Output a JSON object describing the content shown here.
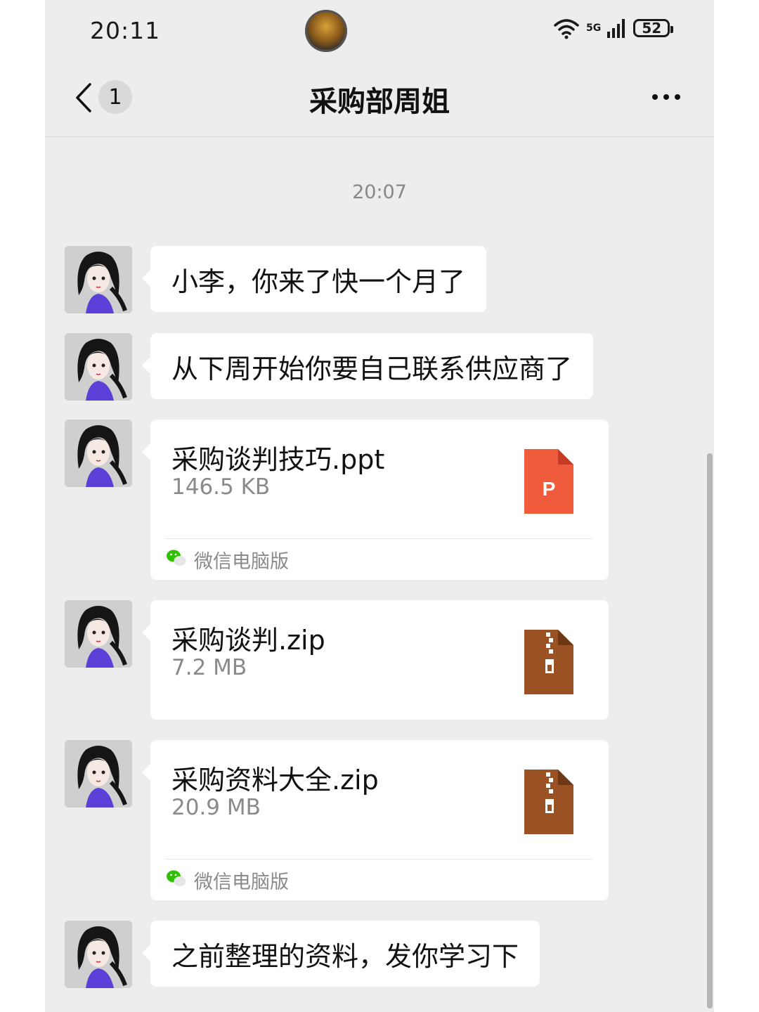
{
  "status_bar": {
    "time": "20:11",
    "network": "5G",
    "battery": "52"
  },
  "header": {
    "unread_count": "1",
    "title": "采购部周姐"
  },
  "chat": {
    "timestamp": "20:07",
    "messages": [
      {
        "type": "text",
        "text": "小李，你来了快一个月了"
      },
      {
        "type": "text",
        "text": "从下周开始你要自己联系供应商了"
      },
      {
        "type": "file",
        "name": "采购谈判技巧.ppt",
        "size": "146.5 KB",
        "file_icon": "ppt-file-icon",
        "footer": "微信电脑版"
      },
      {
        "type": "file",
        "name": "采购谈判.zip",
        "size": "7.2 MB",
        "file_icon": "zip-file-icon"
      },
      {
        "type": "file",
        "name": "采购资料大全.zip",
        "size": "20.9 MB",
        "file_icon": "zip-file-icon",
        "footer": "微信电脑版"
      },
      {
        "type": "text",
        "text": "之前整理的资料，发你学习下"
      }
    ]
  },
  "colors": {
    "chat_bg": "#ededed",
    "bubble_bg": "#ffffff",
    "ppt_icon": "#f05b3c",
    "zip_icon": "#9a5225",
    "wechat_green": "#2dc100"
  }
}
